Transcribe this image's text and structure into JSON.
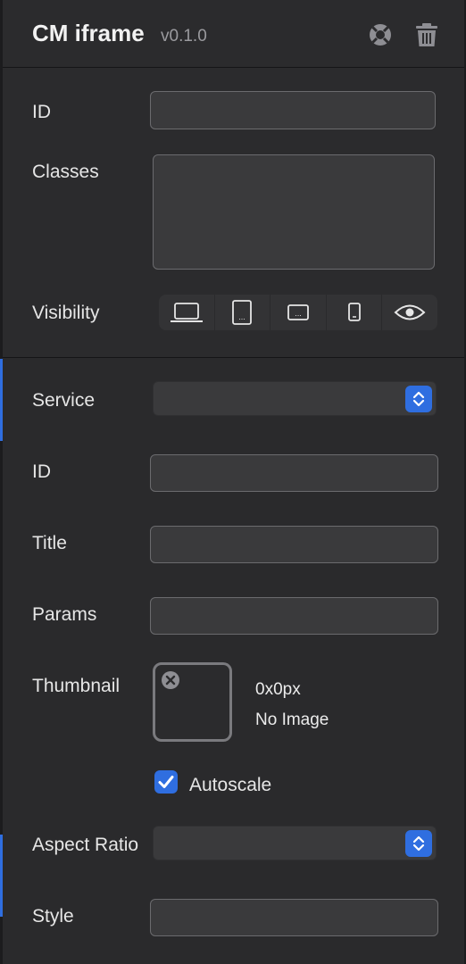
{
  "header": {
    "title": "CM iframe",
    "version": "v0.1.0",
    "help_icon": "help-lifebuoy-icon",
    "delete_icon": "trash-icon"
  },
  "attributes": {
    "id_label": "ID",
    "id_value": "",
    "classes_label": "Classes",
    "classes_value": "",
    "visibility_label": "Visibility",
    "visibility_options": [
      "desktop",
      "tablet",
      "tablet-landscape",
      "phone",
      "hidden-toggle"
    ]
  },
  "settings": {
    "service_label": "Service",
    "service_value": "",
    "id_label": "ID",
    "id_value": "",
    "title_label": "Title",
    "title_value": "",
    "params_label": "Params",
    "params_value": "",
    "thumbnail_label": "Thumbnail",
    "thumbnail_size": "0x0px",
    "thumbnail_status": "No Image",
    "autoscale_label": "Autoscale",
    "autoscale_checked": true,
    "aspect_ratio_label": "Aspect Ratio",
    "aspect_ratio_value": "",
    "style_label": "Style",
    "style_value": ""
  },
  "colors": {
    "accent": "#2f6ee0",
    "panel": "#2b2b2d",
    "field": "#3a3a3c"
  }
}
